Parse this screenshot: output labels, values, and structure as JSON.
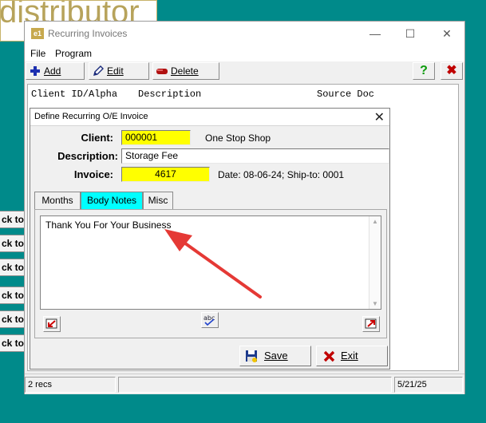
{
  "background": {
    "logo_text": "distributor",
    "back_buttons": [
      "ck to",
      "ck to",
      "ck to",
      "ck to",
      "ck to",
      "ck to"
    ]
  },
  "window": {
    "icon_text": "e1",
    "title": "Recurring Invoices",
    "controls": {
      "minimize": "—",
      "maximize": "☐",
      "close": "✕"
    }
  },
  "menu": [
    "File",
    "Program"
  ],
  "toolbar": {
    "add_label": "Add",
    "edit_label": "Edit",
    "delete_label": "Delete",
    "help_label": "?",
    "exit_label": "✖"
  },
  "grid": {
    "columns": [
      "Client ID/Alpha",
      "Description",
      "Source Doc"
    ]
  },
  "status": {
    "count": "2 recs",
    "middle": "",
    "date": "5/21/25"
  },
  "dialog": {
    "title": "Define Recurring O/E Invoice",
    "client_label": "Client:",
    "client_id": "000001",
    "client_name": "One Stop Shop",
    "description_label": "Description:",
    "description": "Storage Fee",
    "invoice_label": "Invoice:",
    "invoice": "4617",
    "invoice_info": "Date: 08-06-24; Ship-to: 0001",
    "tabs": [
      "Months",
      "Body Notes",
      "Misc"
    ],
    "body_notes": "Thank You For Your Business",
    "save_label": "Save",
    "exit_label": "Exit"
  },
  "colors": {
    "desktop": "#008a8a",
    "highlight_field": "#ffff00",
    "active_tab": "#00ffff",
    "annotation_arrow": "#e53935"
  }
}
